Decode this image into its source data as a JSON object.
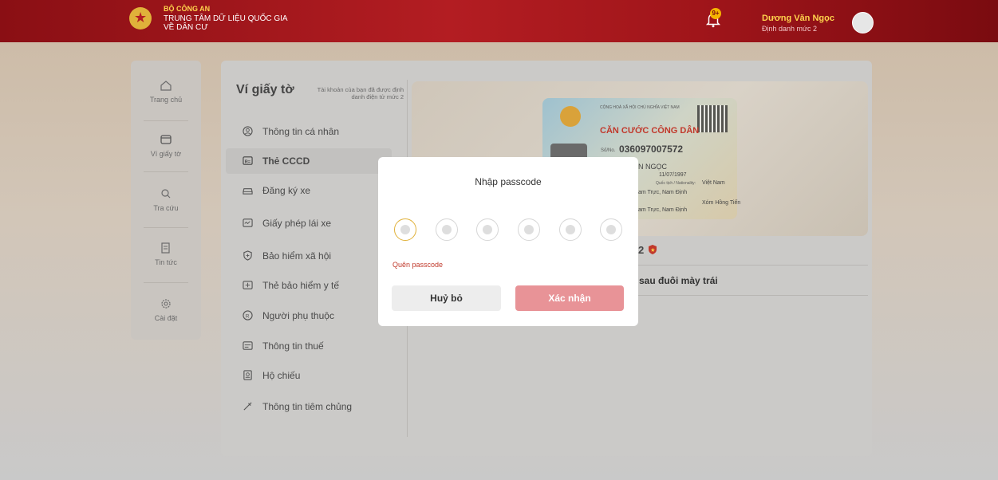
{
  "colors": {
    "brand": "#b31d22",
    "accent": "#f5b400",
    "confirm": "#e89397",
    "forgot": "#c0392b"
  },
  "header": {
    "org_line1": "BỘ CÔNG AN",
    "org_line2": "TRUNG TÂM DỮ LIỆU QUỐC GIA",
    "org_line3": "VỀ DÂN CƯ",
    "notification_badge": "9+",
    "user_name": "Dương Văn Ngọc",
    "user_level": "Định danh mức 2"
  },
  "leftnav": {
    "items": [
      {
        "label": "Trang chủ",
        "icon": "home-icon"
      },
      {
        "label": "Ví giấy tờ",
        "icon": "wallet-icon"
      },
      {
        "label": "Tra cứu",
        "icon": "search-icon"
      },
      {
        "label": "Tin tức",
        "icon": "news-icon"
      },
      {
        "label": "Cài đặt",
        "icon": "gear-icon"
      }
    ]
  },
  "wallet": {
    "title": "Ví giấy tờ",
    "note": "Tài khoản của bạn đã được định danh điện tử mức 2",
    "menu": [
      {
        "label": "Thông tin cá nhân",
        "icon": "person-icon"
      },
      {
        "label": "Thẻ CCCD",
        "icon": "id-card-icon",
        "active": true
      },
      {
        "label": "Đăng ký xe",
        "icon": "car-icon"
      },
      {
        "label": "Giấy phép lái xe",
        "icon": "license-icon"
      },
      {
        "label": "Bảo hiểm xã hội",
        "icon": "shield-plus-icon"
      },
      {
        "label": "Thẻ bảo hiểm y tế",
        "icon": "medical-card-icon"
      },
      {
        "label": "Người phụ thuộc",
        "icon": "dependent-icon"
      },
      {
        "label": "Thông tin thuế",
        "icon": "tax-icon"
      },
      {
        "label": "Hộ chiếu",
        "icon": "passport-icon"
      },
      {
        "label": "Thông tin tiêm chủng",
        "icon": "syringe-icon"
      }
    ]
  },
  "idcard": {
    "header": "CỘNG HOÀ XÃ HỘI CHỦ NGHĨA VIỆT NAM",
    "title": "CĂN CƯỚC CÔNG DÂN",
    "number_label": "Số/No.",
    "number": "036097007572",
    "name": "N NGỌC",
    "dob": "11/07/1997",
    "nationality_label": "Quốc tịch / Nationality:",
    "nationality": "Việt Nam",
    "residence": "Xóm Hồng Tiến",
    "origin_part1": "am Trực, Nam Định",
    "origin_part2": "am Trực, Nam Định"
  },
  "details": {
    "rank": "2",
    "note": "sau đuôi mày trái"
  },
  "modal": {
    "title": "Nhập passcode",
    "forgot": "Quên passcode",
    "cancel": "Huỷ bỏ",
    "confirm": "Xác nhận",
    "digit_count": 6
  }
}
